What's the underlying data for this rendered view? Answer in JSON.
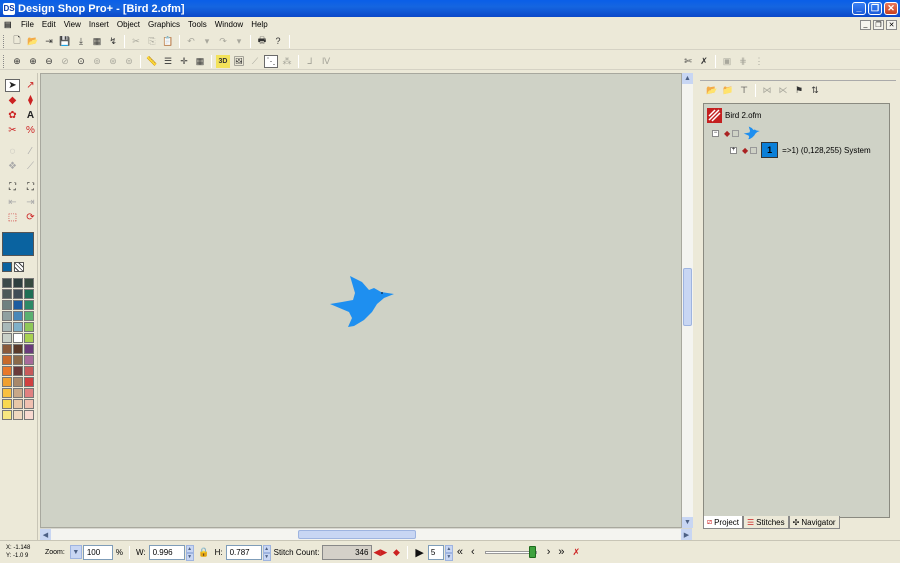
{
  "window": {
    "title": "Design Shop Pro+ - [Bird 2.ofm]",
    "app_icon_text": "DS",
    "controls": {
      "minimize": "_",
      "maximize": "❐",
      "close": "✕"
    }
  },
  "menu": {
    "items": [
      "File",
      "Edit",
      "View",
      "Insert",
      "Object",
      "Graphics",
      "Tools",
      "Window",
      "Help"
    ]
  },
  "canvas": {
    "background": "#cfd2c6",
    "bird_color": "#1e8ff0"
  },
  "panel": {
    "tree": {
      "file_name": "Bird 2.ofm",
      "color_chip_number": "1",
      "color_entry": "=>1) (0,128,255) System"
    },
    "tabs": [
      "Project",
      "Stitches",
      "Navigator"
    ]
  },
  "palette": {
    "current_color": "#0a63a0",
    "swatches": [
      "#3c4a4a",
      "#2e3f3f",
      "#374a40",
      "#4d5a5a",
      "#3f4d57",
      "#1f6f55",
      "#6f8080",
      "#1e5ca0",
      "#2c8a66",
      "#8fa0a0",
      "#4a88b8",
      "#5ab070",
      "#a8b8b8",
      "#7fb0c8",
      "#8fc858",
      "#c8d0c8",
      "#ffffff",
      "#a8d050",
      "#8a5a3a",
      "#5a3a2a",
      "#6a3a7a",
      "#c86a2a",
      "#8a6a4a",
      "#a86a9a",
      "#e8782a",
      "#6a3a3a",
      "#c85a5a",
      "#f0a030",
      "#a8886a",
      "#d04040",
      "#f8c040",
      "#c8a888",
      "#e08080",
      "#f8d850",
      "#e8c8a8",
      "#f0c0b0",
      "#f8e880",
      "#f0d8c0",
      "#f8d8d0"
    ]
  },
  "status": {
    "coord_x": "X: -1.148",
    "coord_y": "Y: -1.0 9",
    "zoom_label": "Zoom:",
    "zoom_value": "100",
    "zoom_unit": "%",
    "width_label": "W:",
    "width_value": "0.996",
    "height_label": "H:",
    "height_value": "0.787",
    "stitch_label": "Stitch Count:",
    "stitch_value": "346",
    "speed_value": "5"
  }
}
